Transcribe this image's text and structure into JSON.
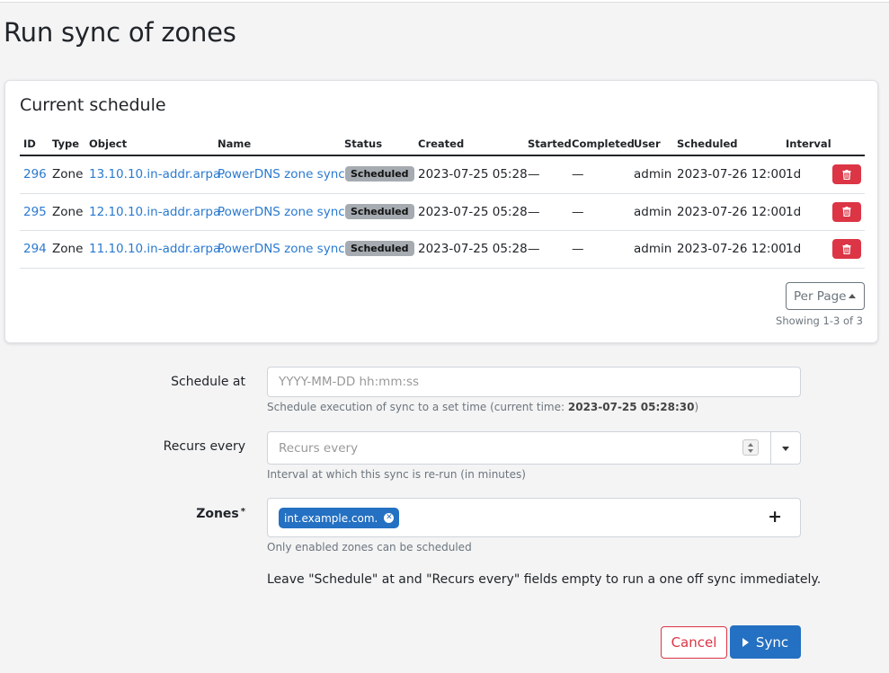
{
  "page": {
    "title": "Run sync of zones"
  },
  "schedule": {
    "title": "Current schedule",
    "columns": [
      "ID",
      "Type",
      "Object",
      "Name",
      "Status",
      "Created",
      "Started",
      "Completed",
      "User",
      "Scheduled",
      "Interval"
    ],
    "rows": [
      {
        "id": "296",
        "type": "Zone",
        "object": "13.10.10.in-addr.arpa.",
        "name": "PowerDNS zone sync",
        "status": "Scheduled",
        "created": "2023-07-25 05:28",
        "started": "—",
        "completed": "—",
        "user": "admin",
        "scheduled": "2023-07-26 12:00",
        "interval": "1d"
      },
      {
        "id": "295",
        "type": "Zone",
        "object": "12.10.10.in-addr.arpa.",
        "name": "PowerDNS zone sync",
        "status": "Scheduled",
        "created": "2023-07-25 05:28",
        "started": "—",
        "completed": "—",
        "user": "admin",
        "scheduled": "2023-07-26 12:00",
        "interval": "1d"
      },
      {
        "id": "294",
        "type": "Zone",
        "object": "11.10.10.in-addr.arpa.",
        "name": "PowerDNS zone sync",
        "status": "Scheduled",
        "created": "2023-07-25 05:28",
        "started": "—",
        "completed": "—",
        "user": "admin",
        "scheduled": "2023-07-26 12:00",
        "interval": "1d"
      }
    ],
    "per_page_label": "Per Page",
    "showing": "Showing 1-3 of 3"
  },
  "form": {
    "schedule_at": {
      "label": "Schedule at",
      "placeholder": "YYYY-MM-DD hh:mm:ss",
      "help_prefix": "Schedule execution of sync to a set time (current time: ",
      "current_time": "2023-07-25 05:28:30",
      "help_suffix": ")"
    },
    "recurs_every": {
      "label": "Recurs every",
      "placeholder": "Recurs every",
      "help": "Interval at which this sync is re-run (in minutes)"
    },
    "zones": {
      "label": "Zones",
      "required_mark": "*",
      "selected": [
        "int.example.com."
      ],
      "help": "Only enabled zones can be scheduled"
    },
    "note": "Leave \"Schedule\" at and \"Recurs every\" fields empty to run a one off sync immediately."
  },
  "actions": {
    "cancel": "Cancel",
    "sync": "Sync"
  },
  "colors": {
    "primary": "#2470c2",
    "danger": "#dc3545",
    "badge": "#a6abb1",
    "link": "#2a7ad0"
  },
  "icons": {
    "delete": "trash-icon",
    "sync": "play-icon",
    "add": "plus-icon",
    "remove_chip": "x-circle-icon"
  }
}
